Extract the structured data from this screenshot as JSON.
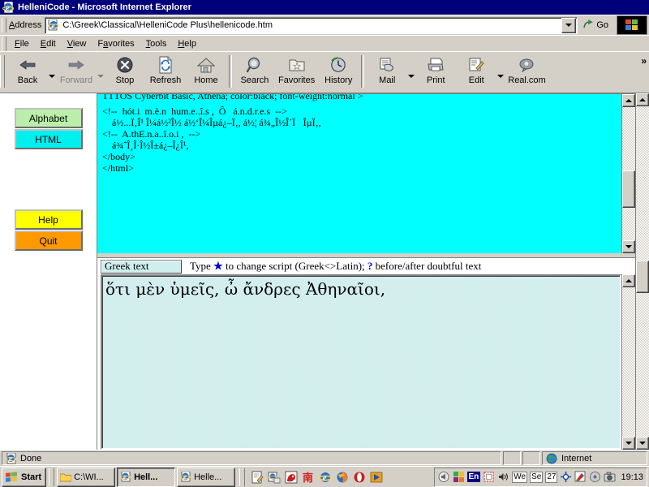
{
  "window": {
    "title": "HelleniCode - Microsoft Internet Explorer",
    "icon": "ie-document-icon"
  },
  "address_bar": {
    "label": "Address",
    "url": "C:\\Greek\\Classical\\HelleniCode Plus\\hellenicode.htm",
    "go_label": "Go"
  },
  "menu": {
    "items": [
      "File",
      "Edit",
      "View",
      "Favorites",
      "Tools",
      "Help"
    ]
  },
  "toolbar": {
    "buttons": [
      {
        "label": "Back",
        "icon": "back-arrow-icon",
        "disabled": false,
        "dropdown": true
      },
      {
        "label": "Forward",
        "icon": "forward-arrow-icon",
        "disabled": true,
        "dropdown": true
      },
      {
        "label": "Stop",
        "icon": "stop-icon",
        "disabled": false,
        "dropdown": false
      },
      {
        "label": "Refresh",
        "icon": "refresh-icon",
        "disabled": false,
        "dropdown": false
      },
      {
        "label": "Home",
        "icon": "home-icon",
        "disabled": false,
        "dropdown": false
      },
      {
        "label": "Search",
        "icon": "search-icon",
        "disabled": false,
        "dropdown": false
      },
      {
        "label": "Favorites",
        "icon": "favorites-star-folder-icon",
        "disabled": false,
        "dropdown": false
      },
      {
        "label": "History",
        "icon": "history-clock-icon",
        "disabled": false,
        "dropdown": false
      },
      {
        "label": "Mail",
        "icon": "mail-icon",
        "disabled": false,
        "dropdown": true
      },
      {
        "label": "Print",
        "icon": "printer-icon",
        "disabled": false,
        "dropdown": false
      },
      {
        "label": "Edit",
        "icon": "edit-pencil-icon",
        "disabled": false,
        "dropdown": true
      },
      {
        "label": "Real.com",
        "icon": "realplayer-icon",
        "disabled": false,
        "dropdown": false
      }
    ],
    "overflow": "»"
  },
  "sidebar": {
    "buttons": [
      {
        "label": "Alphabet",
        "color": "#bbeeaa"
      },
      {
        "label": "HTML",
        "color": "#00f0f0"
      },
      {
        "label": "Help",
        "color": "#ffff00"
      },
      {
        "label": "Quit",
        "color": "#ff9900"
      }
    ]
  },
  "code_frame": {
    "background": "#00ffff",
    "lines": [
      "TTTOS Cyberbit Basic, Athena; color:black; font-weight:normal >",
      "",
      "<!--  hót.i  m.è.n  hum.e..î.s ,  Ô   á.n.d.r.e.s  -->",
      "    á½...Ï‚Î¹ Î¼á½²Î½ á½‘Î¼Îµá¿–Ï‚, á½¦ á¾„Î½Î´ÏÎµÏ‚,",
      "",
      "<!--  A.thE.n.a..î.o.i ,  -->",
      "    á¾ˆÎ¸Î·Î½Î±á¿–Î¿Î¹,",
      "",
      "",
      "</body>",
      "</html>"
    ]
  },
  "greek_frame": {
    "tab_label": "Greek text",
    "hint_prefix": "Type ",
    "hint_star": "★",
    "hint_middle": " to change script (Greek<>Latin); ",
    "hint_question": "?",
    "hint_suffix": " before/after doubtful text",
    "text": "ὅτι μὲν ὑμεῖς, ὦ ἄνδρες Ἀθηναῖοι,",
    "background": "#d3efef"
  },
  "status_bar": {
    "message": "Done",
    "zone": "Internet",
    "zone_icon": "globe-icon",
    "page_icon": "ie-document-icon"
  },
  "taskbar": {
    "start_label": "Start",
    "start_icon": "windows-flag-icon",
    "windows": [
      {
        "label": "C:\\WI...",
        "icon": "folder-icon",
        "active": false
      },
      {
        "label": "Hell...",
        "icon": "ie-document-icon",
        "active": true
      },
      {
        "label": "Helle...",
        "icon": "ie-document-icon",
        "active": false
      }
    ],
    "quick_launch": [
      "notepad-icon",
      "ie-mail-icon",
      "mozilla-dragon-icon",
      "chinese-nan-character-icon",
      "internet-explorer-icon",
      "firefox-icon",
      "opera-icon",
      "media-play-icon"
    ],
    "tray": {
      "icons": [
        "volume-mute-icon",
        "color-squares-icon"
      ],
      "language": "En",
      "boxes": [
        "We",
        "Se",
        "27"
      ],
      "extra_icons": [
        "network-icon",
        "paint-icon",
        "drive-icon",
        "camera-icon"
      ],
      "clock": "19:13"
    }
  }
}
